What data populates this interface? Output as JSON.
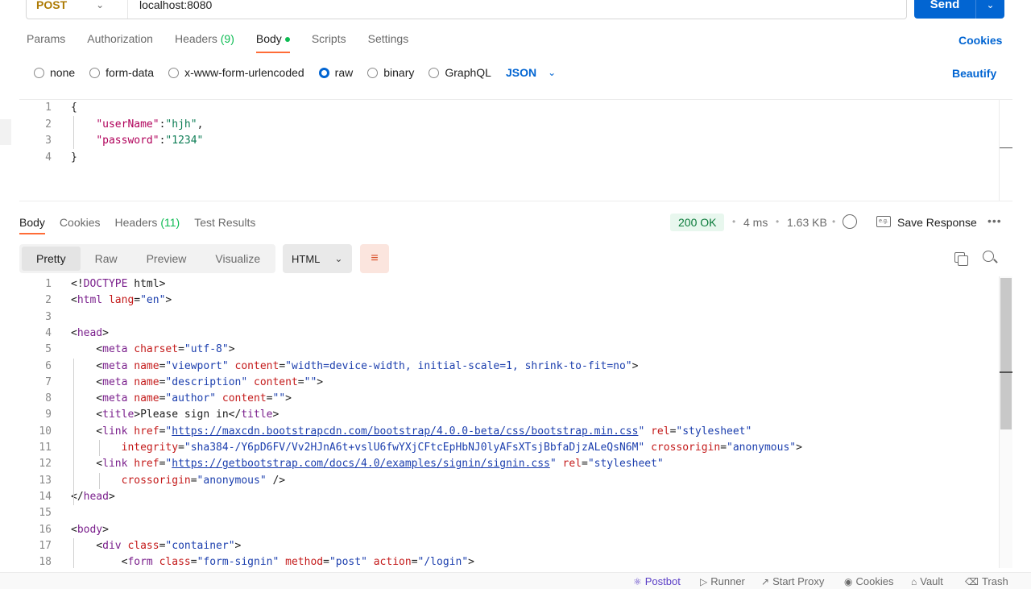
{
  "request": {
    "method": "POST",
    "url": "localhost:8080",
    "send_label": "Send"
  },
  "req_tabs": [
    {
      "label": "Params"
    },
    {
      "label": "Authorization"
    },
    {
      "label": "Headers",
      "count": "(9)"
    },
    {
      "label": "Body"
    },
    {
      "label": "Scripts"
    },
    {
      "label": "Settings"
    }
  ],
  "cookies_label": "Cookies",
  "body_types": [
    "none",
    "form-data",
    "x-www-form-urlencoded",
    "raw",
    "binary",
    "GraphQL"
  ],
  "body_type_selected": "raw",
  "raw_format": "JSON",
  "beautify_label": "Beautify",
  "request_body": [
    "{",
    "    \"userName\":\"hjh\",",
    "    \"password\":\"1234\"",
    "}"
  ],
  "resp_tabs": [
    {
      "label": "Body"
    },
    {
      "label": "Cookies"
    },
    {
      "label": "Headers",
      "count": "(11)"
    },
    {
      "label": "Test Results"
    }
  ],
  "response": {
    "status": "200 OK",
    "time": "4 ms",
    "size": "1.63 KB",
    "save_label": "Save Response",
    "more": "•••"
  },
  "view_modes": [
    "Pretty",
    "Raw",
    "Preview",
    "Visualize"
  ],
  "view_selected": "Pretty",
  "response_format": "HTML",
  "response_lines": [
    "<!DOCTYPE html>",
    "<html lang=\"en\">",
    "",
    "<head>",
    "    <meta charset=\"utf-8\">",
    "    <meta name=\"viewport\" content=\"width=device-width, initial-scale=1, shrink-to-fit=no\">",
    "    <meta name=\"description\" content=\"\">",
    "    <meta name=\"author\" content=\"\">",
    "    <title>Please sign in</title>",
    "    <link href=\"https://maxcdn.bootstrapcdn.com/bootstrap/4.0.0-beta/css/bootstrap.min.css\" rel=\"stylesheet\"",
    "        integrity=\"sha384-/Y6pD6FV/Vv2HJnA6t+vslU6fwYXjCFtcEpHbNJ0lyAFsXTsjBbfaDjzALeQsN6M\" crossorigin=\"anonymous\">",
    "    <link href=\"https://getbootstrap.com/docs/4.0/examples/signin/signin.css\" rel=\"stylesheet\"",
    "        crossorigin=\"anonymous\" />",
    "</head>",
    "",
    "<body>",
    "    <div class=\"container\">",
    "        <form class=\"form-signin\" method=\"post\" action=\"/login\">"
  ],
  "footer": [
    {
      "label": "Postbot",
      "icon": "postbot-icon"
    },
    {
      "label": "Runner",
      "icon": "runner-icon"
    },
    {
      "label": "Start Proxy",
      "icon": "proxy-icon"
    },
    {
      "label": "Cookies",
      "icon": "cookie-icon"
    },
    {
      "label": "Vault",
      "icon": "vault-icon"
    },
    {
      "label": "Trash",
      "icon": "trash-icon"
    }
  ]
}
